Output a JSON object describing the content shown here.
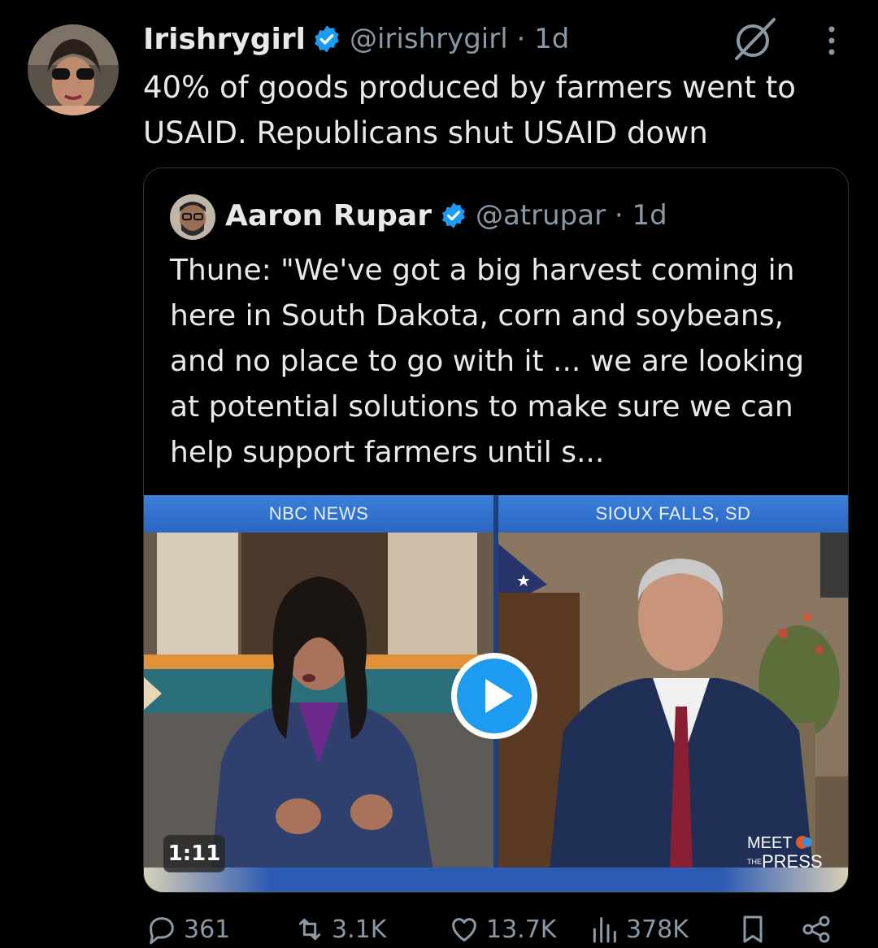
{
  "tweet": {
    "display_name": "Irishrygirl",
    "handle_time": "@irishrygirl · 1d",
    "text": "40% of goods produced by farmers went to USAID. Republicans shut USAID down"
  },
  "quoted_tweet": {
    "display_name": "Aaron Rupar",
    "handle_time": "@atrupar · 1d",
    "text": "Thune: \"We've got a big harvest coming in here in South Dakota, corn and soybeans, and no place to go with it ... we are looking at potential solutions to make sure we can help support farmers until s...",
    "video": {
      "left_banner": "NBC NEWS",
      "right_banner": "SIOUX FALLS, SD",
      "duration": "1:11",
      "logo_top": "MEET",
      "logo_small": "THE",
      "logo_bottom": "PRESS"
    }
  },
  "actions": {
    "replies": "361",
    "reposts": "3.1K",
    "likes": "13.7K",
    "views": "378K"
  },
  "icons": [
    "verified-badge-icon",
    "grok-icon",
    "more-options-icon",
    "play-icon",
    "reply-icon",
    "repost-icon",
    "like-icon",
    "views-icon",
    "bookmark-icon",
    "share-icon"
  ],
  "colors": {
    "background": "#000000",
    "text": "#e7e9ea",
    "secondary": "#8b98a5",
    "verified": "#1d9bf0",
    "play": "#1d9bf0"
  }
}
